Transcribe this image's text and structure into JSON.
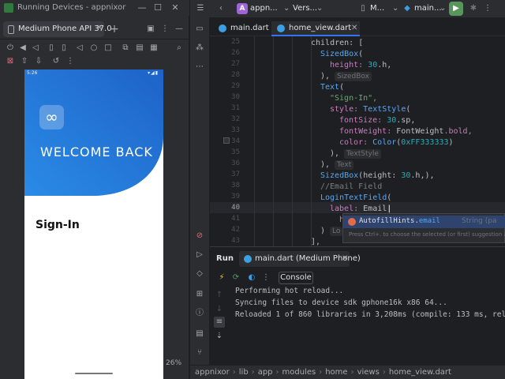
{
  "devices_window": {
    "title": "Running Devices - appnixor",
    "device_tab": "Medium Phone API 37.0",
    "zoom": "26%"
  },
  "phone": {
    "clock": "5:26",
    "signal": "▾◢▮",
    "welcome": "WELCOME BACK",
    "signin": "Sign-In",
    "logo_glyph": "∞",
    "gradient_colors": [
      "#1e62c8",
      "#2a8be6"
    ]
  },
  "ide": {
    "project_badge": "A",
    "project_name": "appn...",
    "vcs": "Vers...",
    "device": "M...",
    "run_config": "main...",
    "tabs": [
      "main.dart",
      "home_view.dart"
    ],
    "line_numbers": [
      "25",
      "26",
      "27",
      "28",
      "29",
      "30",
      "31",
      "32",
      "33",
      "34",
      "35",
      "36",
      "37",
      "38",
      "39",
      "40",
      "41",
      "42",
      "43"
    ],
    "code": {
      "l25": "children: [",
      "l26_fn": "SizedBox",
      "l26": "(",
      "l27_key": "height: ",
      "l27_num": "30",
      "l27_rest": ".h,",
      "l28": "),",
      "hint_sizedbox": "SizedBox",
      "l29_fn": "Text",
      "l29": "(",
      "l30": "\"Sign-In\",",
      "l31_key": "style: ",
      "l31_fn": "TextStyle",
      "l31": "(",
      "l32_key": "fontSize: ",
      "l32_num": "30",
      "l32_rest": ".sp,",
      "l33_key": "fontWeight: ",
      "l33_val": "FontWeight",
      "l33_rest": ".bold,",
      "l34_key": "color: ",
      "l34_fn": "Color",
      "l34_num": "0xFF333333",
      "l34_rest": ")",
      "l35": "),",
      "hint_textstyle": "TextStyle",
      "l36": "),",
      "hint_text": "Text",
      "l37_fn": "SizedBox",
      "l37_a": "(height: ",
      "l37_num": "30",
      "l37_rest": ".h,),",
      "l38": "//Email Field",
      "l39_fn": "LoginTextField",
      "l39": "(",
      "l40_key": "label: ",
      "l40_val": "Email",
      "l41": "h",
      "l42": ")",
      "hint_lo": "Lo",
      "l43": "],"
    },
    "autocomplete": {
      "item_prefix": "AutofillHints.",
      "item_match": "email",
      "item_type": "String (pa",
      "hint": "Press Ctrl+. to choose the selected (or first) suggestion a"
    },
    "run": {
      "label": "Run",
      "tab": "main.dart (Medium Phone)",
      "console_button": "Console",
      "log": [
        "Performing hot reload...",
        "Syncing files to device sdk gphone16k x86 64...",
        "Reloaded 1 of 860 libraries in 3,208ms (compile: 133 ms, reload: 117"
      ]
    },
    "breadcrumb": [
      "appnixor",
      "lib",
      "app",
      "modules",
      "home",
      "views",
      "home_view.dart"
    ]
  }
}
